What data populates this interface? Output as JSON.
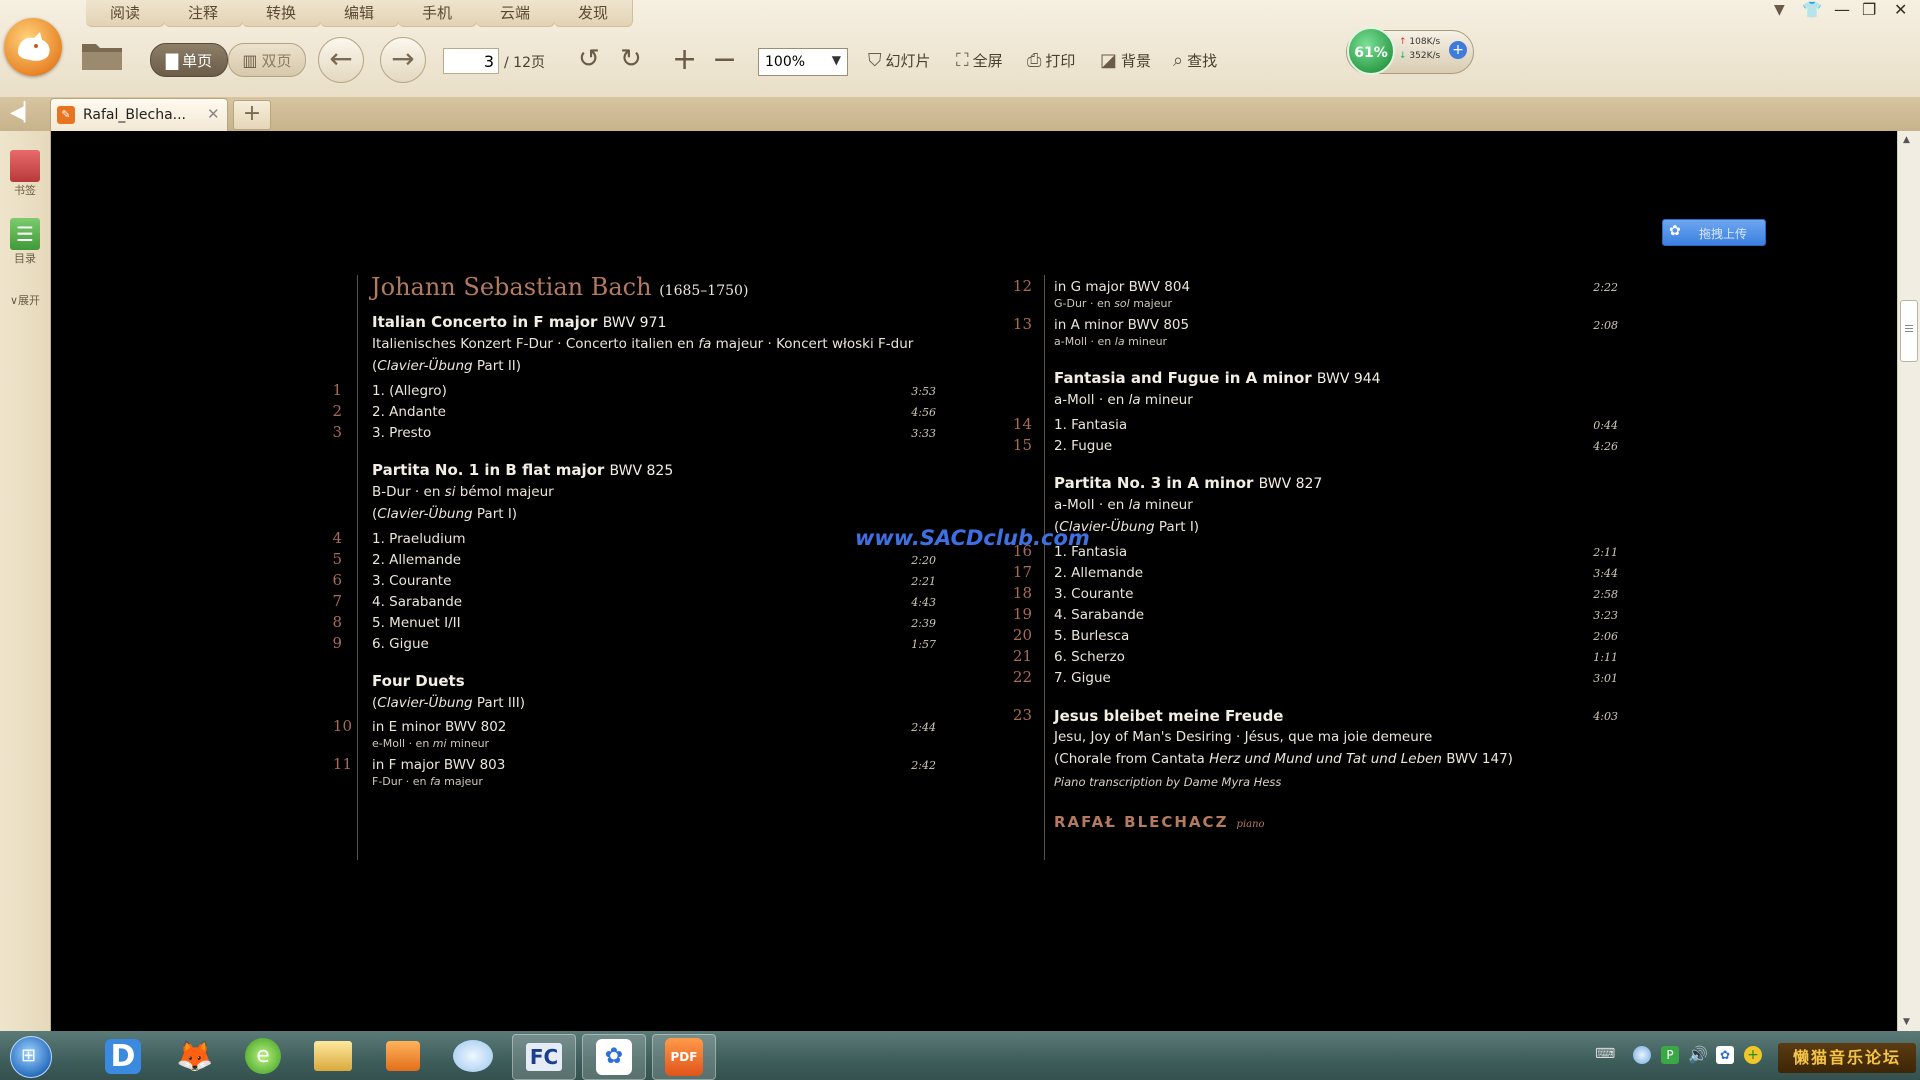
{
  "menu": [
    "阅读",
    "注释",
    "转换",
    "编辑",
    "手机",
    "云端",
    "发现"
  ],
  "toolbar": {
    "single_page": "单页",
    "double_page": "双页",
    "current_page": "3",
    "total_pages": "/ 12页",
    "zoom": "100%",
    "slideshow": "幻灯片",
    "fullscreen": "全屏",
    "print": "打印",
    "background": "背景",
    "find": "查找"
  },
  "status": {
    "cpu": "61%",
    "upload": "108K/s",
    "download": "352K/s"
  },
  "tab": {
    "title": "Rafal_Blecha..."
  },
  "sidebar": {
    "bookmarks": "书签",
    "toc": "目录",
    "expand": "展开"
  },
  "upload_button": "拖拽上传",
  "watermark": "www.SACDclub.com",
  "document": {
    "composer": "Johann Sebastian Bach",
    "composer_dates": "(1685–1750)",
    "left": {
      "italian": {
        "title": "Italian Concerto in F major",
        "bwv": "BWV 971",
        "line1_a": "Italienisches Konzert F-Dur · Concerto italien en ",
        "line1_em": "fa",
        "line1_b": " majeur · Koncert włoski F-dur",
        "line2_a": "(",
        "line2_em": "Clavier-Übung",
        "line2_b": " Part II)",
        "tracks": [
          {
            "num": "1",
            "title": "1. (Allegro)",
            "time": "3:53"
          },
          {
            "num": "2",
            "title": "2. Andante",
            "time": "4:56"
          },
          {
            "num": "3",
            "title": "3. Presto",
            "time": "3:33"
          }
        ]
      },
      "partita1": {
        "title": "Partita No. 1 in B flat major",
        "bwv": "BWV 825",
        "line1_a": "B-Dur · en ",
        "line1_em": "si",
        "line1_b": " bémol majeur",
        "line2_a": "(",
        "line2_em": "Clavier-Übung",
        "line2_b": " Part I)",
        "tracks": [
          {
            "num": "4",
            "title": "1. Praeludium",
            "time": ""
          },
          {
            "num": "5",
            "title": "2. Allemande",
            "time": "2:20"
          },
          {
            "num": "6",
            "title": "3. Courante",
            "time": "2:21"
          },
          {
            "num": "7",
            "title": "4. Sarabande",
            "time": "4:43"
          },
          {
            "num": "8",
            "title": "5. Menuet I/II",
            "time": "2:39"
          },
          {
            "num": "9",
            "title": "6. Gigue",
            "time": "1:57"
          }
        ]
      },
      "duets": {
        "title": "Four Duets",
        "line2_a": "(",
        "line2_em": "Clavier-Übung",
        "line2_b": " Part III)",
        "tracks": [
          {
            "num": "10",
            "title": "in E minor BWV 802",
            "sub_a": "e-Moll · en ",
            "sub_em": "mi",
            "sub_b": " mineur",
            "time": "2:44"
          },
          {
            "num": "11",
            "title": "in F major BWV 803",
            "sub_a": "F-Dur · en ",
            "sub_em": "fa",
            "sub_b": " majeur",
            "time": "2:42"
          }
        ]
      }
    },
    "right": {
      "duets_cont": [
        {
          "num": "12",
          "title": "in G major BWV 804",
          "sub_a": "G-Dur · en ",
          "sub_em": "sol",
          "sub_b": " majeur",
          "time": "2:22"
        },
        {
          "num": "13",
          "title": "in A minor BWV 805",
          "sub_a": "a-Moll · en ",
          "sub_em": "la",
          "sub_b": " mineur",
          "time": "2:08"
        }
      ],
      "fantasia": {
        "title": "Fantasia and Fugue in A minor",
        "bwv": "BWV 944",
        "line1_a": "a-Moll · en ",
        "line1_em": "la",
        "line1_b": " mineur",
        "tracks": [
          {
            "num": "14",
            "title": "1. Fantasia",
            "time": "0:44"
          },
          {
            "num": "15",
            "title": "2. Fugue",
            "time": "4:26"
          }
        ]
      },
      "partita3": {
        "title": "Partita No. 3 in A minor",
        "bwv": "BWV 827",
        "line1_a": "a-Moll · en ",
        "line1_em": "la",
        "line1_b": " mineur",
        "line2_a": "(",
        "line2_em": "Clavier-Übung",
        "line2_b": " Part I)",
        "tracks": [
          {
            "num": "16",
            "title": "1. Fantasia",
            "time": "2:11"
          },
          {
            "num": "17",
            "title": "2. Allemande",
            "time": "3:44"
          },
          {
            "num": "18",
            "title": "3. Courante",
            "time": "2:58"
          },
          {
            "num": "19",
            "title": "4. Sarabande",
            "time": "3:23"
          },
          {
            "num": "20",
            "title": "5. Burlesca",
            "time": "2:06"
          },
          {
            "num": "21",
            "title": "6. Scherzo",
            "time": "1:11"
          },
          {
            "num": "22",
            "title": "7. Gigue",
            "time": "3:01"
          }
        ]
      },
      "jesus": {
        "num": "23",
        "title": "Jesus bleibet meine Freude",
        "time": "4:03",
        "line1": "Jesu, Joy of Man's Desiring · Jésus, que ma joie demeure",
        "line2_a": "(Chorale from Cantata ",
        "line2_em": "Herz und Mund und Tat und Leben",
        "line2_b": "  BWV 147)",
        "line3": "Piano transcription by Dame Myra Hess"
      },
      "performer": "RAFAŁ BLECHACZ",
      "instrument": "piano"
    }
  },
  "taskbar": {
    "forum": "懒猫音乐论坛"
  },
  "colors": {
    "accent_rust": "#b37a5f",
    "watermark_blue": "#3f6fe0",
    "cpu_green": "#2c9b46"
  }
}
